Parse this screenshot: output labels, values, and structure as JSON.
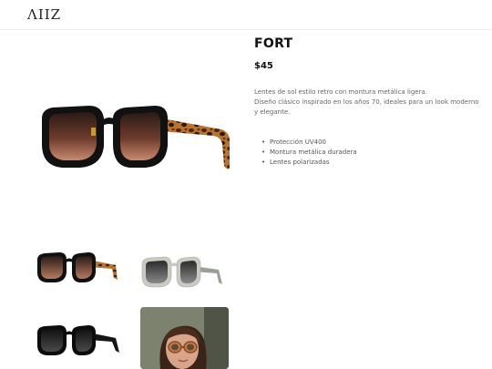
{
  "header": {
    "logo": "ΛΙΙΖ"
  },
  "product": {
    "name": "FORT",
    "price": "$45",
    "description": [
      "Lentes de sol estilo retro con montura metálica ligera.",
      "Diseño clásico inspirado en los años 70, ideales para un look moderno",
      "y elegante."
    ],
    "features": [
      "Protección UV400",
      "Montura metálica duradera",
      "Lentes polarizadas"
    ]
  },
  "gallery": {
    "thumbnails": [
      "tortoise-brown",
      "clear-grey",
      "black",
      "lifestyle-photo"
    ]
  },
  "colors": {
    "frame_black": "#111111",
    "tortoise": "#8a4a1c",
    "lens_brown": "#6b3a2a",
    "clear_frame": "#c9cbc3"
  }
}
